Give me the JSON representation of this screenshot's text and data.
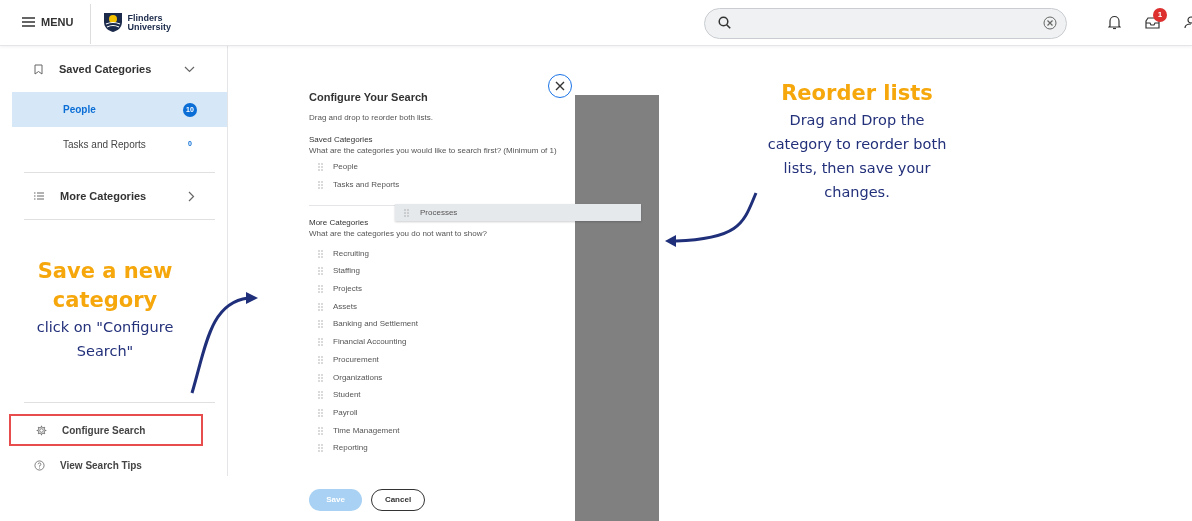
{
  "header": {
    "menu_label": "MENU",
    "logo_lines": [
      "Flinders",
      "University"
    ],
    "notification_badge": "1"
  },
  "sidebar": {
    "saved": {
      "label": "Saved Categories",
      "expanded": true,
      "items": [
        {
          "label": "People",
          "count": "10",
          "selected": true
        },
        {
          "label": "Tasks and Reports",
          "count": "0",
          "selected": false
        }
      ]
    },
    "more": {
      "label": "More Categories",
      "expanded": false
    },
    "configure": {
      "label": "Configure Search",
      "highlighted": true
    },
    "tips": {
      "label": "View Search Tips"
    }
  },
  "dialog": {
    "title": "Configure Your Search",
    "instruction": "Drag and drop to reorder both lists.",
    "saved_heading": "Saved Categories",
    "saved_question": "What are the categories you would like to search first? (Minimum of 1)",
    "saved_items": [
      "People",
      "Tasks and Reports"
    ],
    "more_heading": "More Categories",
    "more_question": "What are the categories you do not want to show?",
    "more_items": [
      "Recruiting",
      "Staffing",
      "Projects",
      "Assets",
      "Banking and Settlement",
      "Financial Accounting",
      "Procurement",
      "Organizations",
      "Student",
      "Payroll",
      "Time Management",
      "Reporting"
    ],
    "dragged_item": "Processes",
    "save": {
      "label": "Save",
      "disabled": true
    },
    "cancel": {
      "label": "Cancel"
    }
  },
  "annotations": [
    {
      "title": "Save a new category",
      "body": "click on \"Configure Search\""
    },
    {
      "title": "Reorder lists",
      "body": "Drag and Drop the category to reorder both lists, then save your changes."
    }
  ]
}
